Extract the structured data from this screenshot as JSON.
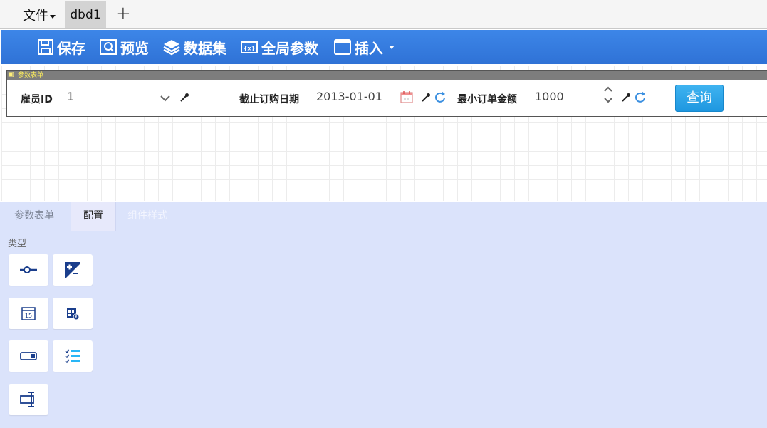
{
  "tabbar": {
    "file_menu_label": "文件",
    "doc_tab_label": "dbd1",
    "add_tab_glyph": "+"
  },
  "toolbar": {
    "items": [
      {
        "label": "保存",
        "icon": "save-icon"
      },
      {
        "label": "预览",
        "icon": "preview-icon"
      },
      {
        "label": "数据集",
        "icon": "dataset-icon"
      },
      {
        "label": "全局参数",
        "icon": "global-params-icon"
      },
      {
        "label": "插入",
        "icon": "insert-icon",
        "has_dropdown": true
      }
    ]
  },
  "param_form": {
    "title": "参数表单",
    "fields": [
      {
        "label": "雇员ID",
        "value": "1",
        "control": "dropdown"
      },
      {
        "label": "截止订购日期",
        "value": "2013-01-01",
        "control": "date"
      },
      {
        "label": "最小订单金额",
        "value": "1000",
        "control": "number-spinner"
      }
    ],
    "query_button": "查询"
  },
  "panel": {
    "tabs": [
      "参数表单",
      "配置",
      "组件样式"
    ],
    "active_tab": "配置",
    "type_label": "类型",
    "type_buttons": [
      "slider-icon",
      "plus-minus-icon",
      "calendar-icon",
      "calendar-grid-icon",
      "toggle-input-icon",
      "checklist-icon",
      "text-cursor-icon"
    ]
  },
  "colors": {
    "toolbar": "#3079e0",
    "query_button": "#2aa4e8",
    "panel_bg": "#dbe3fb",
    "accent_icon": "#29b6f6"
  }
}
